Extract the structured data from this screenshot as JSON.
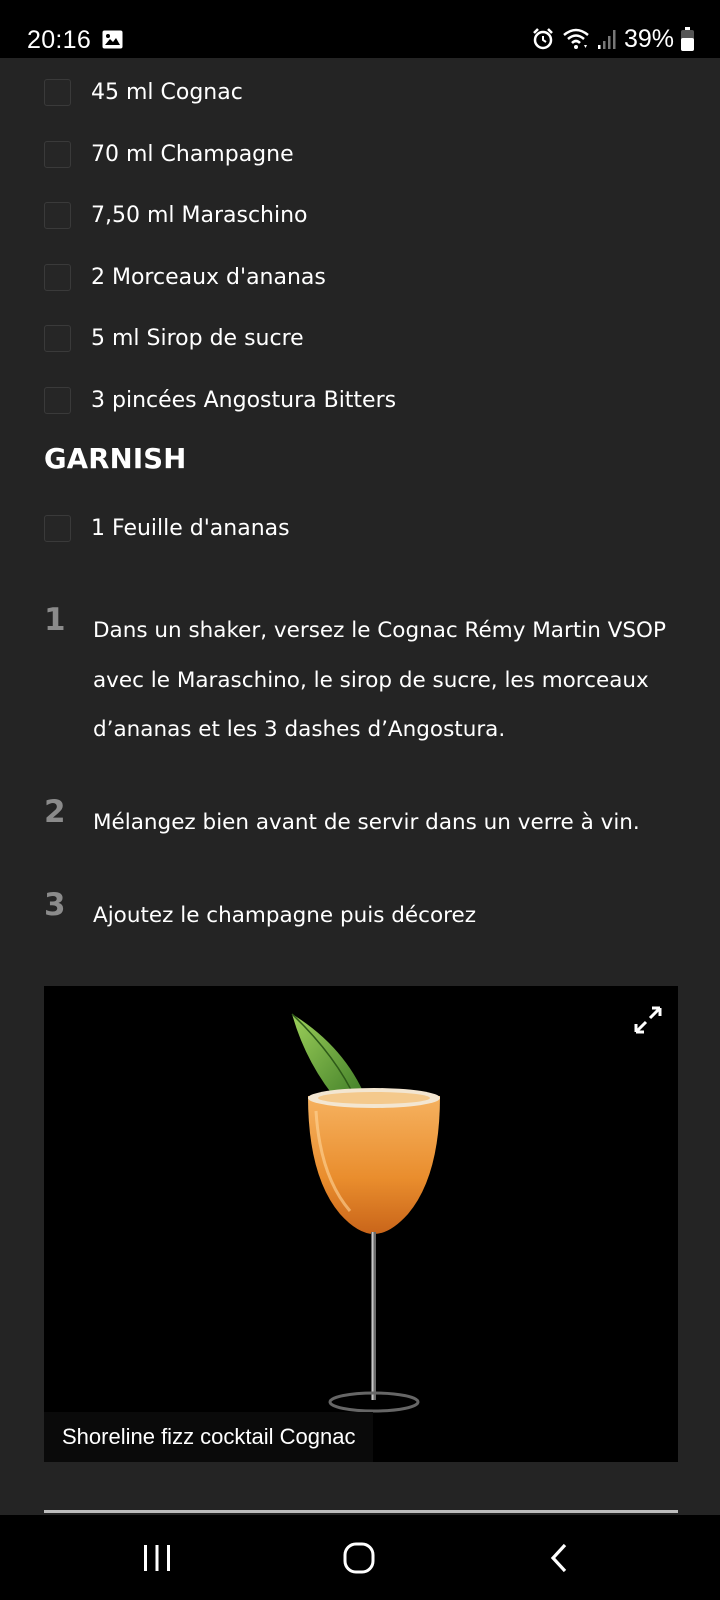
{
  "status_bar": {
    "time": "20:16",
    "battery": "39%",
    "icons": [
      "gallery-icon",
      "alarm-icon",
      "wifi-icon",
      "signal-icon",
      "battery-icon"
    ]
  },
  "ingredients": [
    {
      "label": "45 ml Cognac"
    },
    {
      "label": "70 ml Champagne"
    },
    {
      "label": "7,50 ml Maraschino"
    },
    {
      "label": "2 Morceaux d'ananas"
    },
    {
      "label": "5 ml Sirop de sucre"
    },
    {
      "label": "3 pincées Angostura Bitters"
    }
  ],
  "garnish": {
    "title": "GARNISH",
    "items": [
      {
        "label": "1 Feuille d'ananas"
      }
    ]
  },
  "steps": [
    {
      "number": "1",
      "text": "Dans un shaker, versez le Cognac Rémy Martin VSOP avec le Maraschino, le sirop de sucre, les morceaux d’ananas et les 3 dashes d’Angostura."
    },
    {
      "number": "2",
      "text": "Mélangez bien avant de servir dans un verre à vin."
    },
    {
      "number": "3",
      "text": "Ajoutez le champagne puis décorez"
    }
  ],
  "image": {
    "caption": "Shoreline fizz cocktail Cognac",
    "expand_icon": "expand-icon"
  },
  "nav_bar": {
    "icons": [
      "recent-apps-icon",
      "home-icon",
      "back-icon"
    ]
  },
  "colors": {
    "background": "#242424",
    "step_number": "#8b8b8b",
    "bars": "#000000"
  }
}
